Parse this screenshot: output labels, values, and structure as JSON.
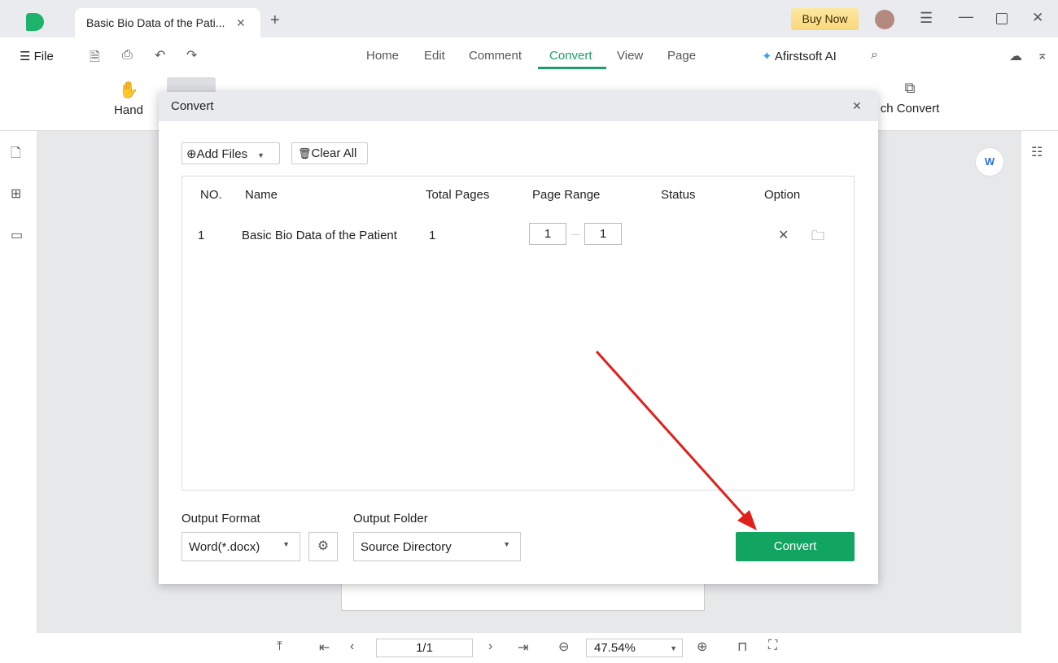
{
  "app": {
    "tab_title": "Basic Bio Data of the Pati...",
    "buy_now": "Buy Now"
  },
  "menu": {
    "file": "File",
    "tabs": [
      "Home",
      "Edit",
      "Comment",
      "Convert",
      "View",
      "Page"
    ],
    "active_tab": "Convert",
    "ai": "Afirstsoft AI"
  },
  "toolbar": {
    "hand": "Hand",
    "batch_convert": "ch Convert"
  },
  "dialog": {
    "title": "Convert",
    "add_files": "Add Files",
    "clear_all": "Clear All",
    "columns": [
      "NO.",
      "Name",
      "Total Pages",
      "Page Range",
      "Status",
      "Option"
    ],
    "rows": [
      {
        "no": "1",
        "name": "Basic Bio Data of the Patient",
        "total_pages": "1",
        "range_from": "1",
        "range_to": "1",
        "status": ""
      }
    ],
    "output_format_label": "Output Format",
    "output_format": "Word(*.docx)",
    "output_folder_label": "Output Folder",
    "output_folder": "Source Directory",
    "convert": "Convert"
  },
  "bottom": {
    "page": "1/1",
    "zoom": "47.54%"
  },
  "colors": {
    "accent": "#12a461",
    "arrow": "#e0201b"
  }
}
